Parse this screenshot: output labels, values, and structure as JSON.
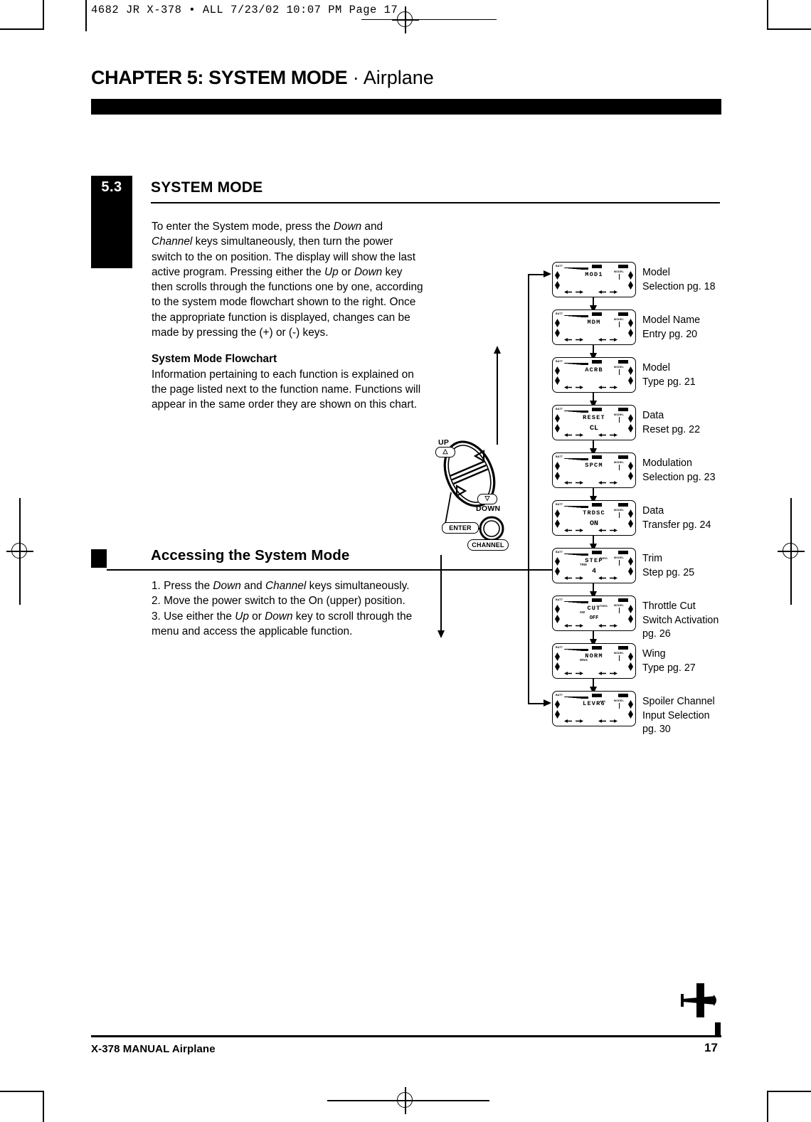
{
  "slug": "4682 JR X-378 • ALL  7/23/02  10:07 PM  Page 17",
  "chapter": {
    "bold": "CHAPTER 5: SYSTEM MODE",
    "separator": " · ",
    "light": "Airplane"
  },
  "section": {
    "number": "5.3",
    "title": "SYSTEM MODE",
    "paragraph1_a": "To enter the System mode, press the ",
    "paragraph1_down": "Down",
    "paragraph1_b": " and ",
    "paragraph1_channel": "Channel",
    "paragraph1_c": " keys simultaneously, then turn the power switch to the on position. The display will show the last active program. Pressing either the ",
    "paragraph1_up": "Up",
    "paragraph1_d": " or ",
    "paragraph1_down2": "Down",
    "paragraph1_e": " key then scrolls through the functions one by one, according to the system mode flowchart shown to the right. Once the appropriate function is displayed, changes can be made by pressing the (+) or (-) keys.",
    "subhead": "System Mode Flowchart",
    "paragraph2": "Information pertaining to each function is explained on the page listed next to the function name. Functions will appear in the same order they are shown on this chart."
  },
  "accessing": {
    "title": "Accessing the System Mode",
    "step1_a": "1. Press the ",
    "step1_down": "Down",
    "step1_b": " and ",
    "step1_channel": "Channel",
    "step1_c": " keys simultaneously.",
    "step2": "2. Move the power switch to the On (upper) position.",
    "step3_a": "3. Use either the ",
    "step3_up": "Up",
    "step3_b": " or ",
    "step3_down": "Down",
    "step3_c": " key to scroll through the menu and access the applicable function."
  },
  "keypad": {
    "up_label": "UP",
    "up_glyph": "△",
    "down_label": "DOWN",
    "down_glyph": "▽",
    "enter_label": "ENTER",
    "channel_label": "CHANNEL"
  },
  "lcd_common": {
    "batt_label": "BATT",
    "tag_mid": "",
    "tag_right": "",
    "model_label": "MODEL"
  },
  "flow": [
    {
      "screen": "MOD1",
      "sub": "",
      "value": "",
      "thro": "",
      "label_line1": "Model",
      "label_line2": "Selection pg. 18",
      "label_line3": ""
    },
    {
      "screen": "MDM",
      "sub": "",
      "value": "",
      "thro": "",
      "label_line1": "Model Name",
      "label_line2": "Entry pg. 20",
      "label_line3": ""
    },
    {
      "screen": "ACRB",
      "sub": "",
      "value": "",
      "thro": "",
      "label_line1": "Model",
      "label_line2": "Type pg. 21",
      "label_line3": ""
    },
    {
      "screen": "RESET",
      "sub": "",
      "value": "CL",
      "thro": "",
      "label_line1": "Data",
      "label_line2": "Reset pg. 22",
      "label_line3": ""
    },
    {
      "screen": "SPCM",
      "sub": "",
      "value": "",
      "thro": "",
      "label_line1": "Modulation",
      "label_line2": "Selection pg. 23",
      "label_line3": ""
    },
    {
      "screen": "TRDSC",
      "sub": "",
      "value": "ON",
      "thro": "",
      "label_line1": "Data",
      "label_line2": "Transfer pg. 24",
      "label_line3": ""
    },
    {
      "screen": "STEP",
      "sub": "TRM",
      "value": "4",
      "thro": "THRO",
      "label_line1": "Trim",
      "label_line2": "Step pg. 25",
      "label_line3": ""
    },
    {
      "screen": "CUT",
      "sub": "SW",
      "value": "OFF",
      "thro": "THRO",
      "label_line1": "Throttle Cut",
      "label_line2": "Switch Activation",
      "label_line3": "pg. 26"
    },
    {
      "screen": "NORM",
      "sub": "WNG",
      "value": "",
      "thro": "",
      "label_line1": "Wing",
      "label_line2": "Type pg. 27",
      "label_line3": ""
    },
    {
      "screen": "LEVR6",
      "sub": "",
      "value": "",
      "thro": "AUX",
      "label_line1": "Spoiler Channel",
      "label_line2": "Input Selection",
      "label_line3": "pg. 30"
    }
  ],
  "footer": {
    "left": "X-378  MANUAL Airplane",
    "page": "17"
  }
}
